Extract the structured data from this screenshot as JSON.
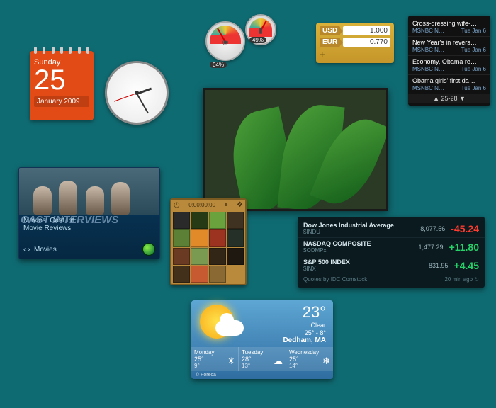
{
  "calendar": {
    "dayname": "Sunday",
    "date": "25",
    "monthyear": "January 2009"
  },
  "cpu": {
    "val1": "04%",
    "val2": "49%"
  },
  "currency": {
    "rows": [
      {
        "code": "USD",
        "value": "1.000"
      },
      {
        "code": "EUR",
        "value": "0.770"
      }
    ],
    "add": "+"
  },
  "news": {
    "items": [
      {
        "title": "Cross-dressing wife-…",
        "src": "MSNBC N…",
        "time": "Tue Jan 6"
      },
      {
        "title": "New Year's in revers…",
        "src": "MSNBC N…",
        "time": "Tue Jan 6"
      },
      {
        "title": "Economy, Obama re…",
        "src": "MSNBC N…",
        "time": "Tue Jan 6"
      },
      {
        "title": "Obama girls' first da…",
        "src": "MSNBC N…",
        "time": "Tue Jan 6"
      }
    ],
    "pager": "▲  25-28  ▼"
  },
  "media": {
    "line1": "Movies: Cast Int…",
    "line2": "Movie Reviews",
    "overlay": "CAST INTERVIEWS",
    "nav_prev": "‹",
    "nav_next": "›",
    "footer": "Movies"
  },
  "puzzle": {
    "timer": "0:00:00:00",
    "colors": [
      "#2a2a2a",
      "#263a16",
      "#6aa23e",
      "#3f3220",
      "#5b8036",
      "#e08a2a",
      "#9c3220",
      "#243028",
      "#6b3a22",
      "#7a9a52",
      "#322616",
      "#1e1810",
      "#42301a",
      "#c85a32",
      "#8a6a32",
      "#000000"
    ]
  },
  "stocks": {
    "rows": [
      {
        "name": "Dow Jones Industrial Average",
        "sym": "$INDU",
        "price": "8,077.56",
        "chg": "-45.24",
        "dir": "down"
      },
      {
        "name": "NASDAQ COMPOSITE",
        "sym": "$COMPx",
        "price": "1,477.29",
        "chg": "+11.80",
        "dir": "up"
      },
      {
        "name": "S&P 500 INDEX",
        "sym": "$INX",
        "price": "831.95",
        "chg": "+4.45",
        "dir": "up"
      }
    ],
    "credit": "Quotes by IDC Comstock",
    "ago": "20 min ago ↻"
  },
  "weather": {
    "temp": "23°",
    "cond": "Clear",
    "range": "25° - 8°",
    "loc": "Dedham, MA",
    "forecast": [
      {
        "day": "Monday",
        "hi": "25°",
        "lo": "9°",
        "icon": "☀"
      },
      {
        "day": "Tuesday",
        "hi": "28°",
        "lo": "13°",
        "icon": "☁"
      },
      {
        "day": "Wednesday",
        "hi": "25°",
        "lo": "14°",
        "icon": "❄"
      }
    ],
    "credit": "© Foreca"
  }
}
